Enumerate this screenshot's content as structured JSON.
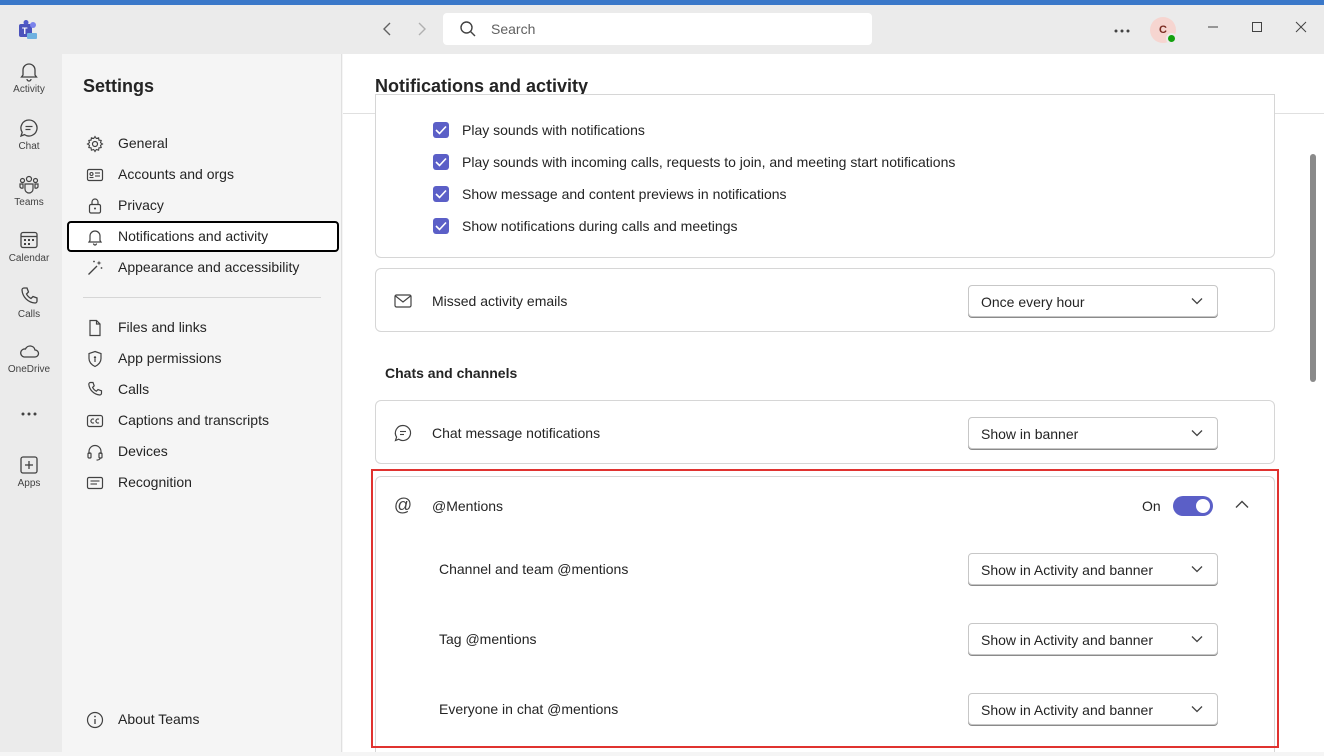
{
  "topbar": {
    "search_placeholder": "Search"
  },
  "user": {
    "initial": "C"
  },
  "rail": {
    "items": [
      {
        "label": "Activity",
        "icon": "bell-icon"
      },
      {
        "label": "Chat",
        "icon": "chat-icon"
      },
      {
        "label": "Teams",
        "icon": "teams-icon"
      },
      {
        "label": "Calendar",
        "icon": "calendar-icon"
      },
      {
        "label": "Calls",
        "icon": "phone-icon"
      },
      {
        "label": "OneDrive",
        "icon": "cloud-icon"
      },
      {
        "label": "",
        "icon": "more-icon"
      },
      {
        "label": "Apps",
        "icon": "apps-icon"
      }
    ]
  },
  "settings": {
    "title": "Settings",
    "nav": [
      {
        "label": "General",
        "icon": "gear-icon"
      },
      {
        "label": "Accounts and orgs",
        "icon": "id-card-icon"
      },
      {
        "label": "Privacy",
        "icon": "lock-icon"
      },
      {
        "label": "Notifications and activity",
        "icon": "bell-icon",
        "active": true
      },
      {
        "label": "Appearance and accessibility",
        "icon": "magic-wand-icon"
      },
      {
        "label": "Files and links",
        "icon": "file-icon"
      },
      {
        "label": "App permissions",
        "icon": "shield-icon"
      },
      {
        "label": "Calls",
        "icon": "phone-icon"
      },
      {
        "label": "Captions and transcripts",
        "icon": "captions-icon"
      },
      {
        "label": "Devices",
        "icon": "headset-icon"
      },
      {
        "label": "Recognition",
        "icon": "recognition-icon"
      }
    ],
    "about": "About Teams"
  },
  "main": {
    "title": "Notifications and activity",
    "checkboxes": [
      {
        "label": "Play sounds with notifications",
        "checked": true
      },
      {
        "label": "Play sounds with incoming calls, requests to join, and meeting start notifications",
        "checked": true
      },
      {
        "label": "Show message and content previews in notifications",
        "checked": true
      },
      {
        "label": "Show notifications during calls and meetings",
        "checked": true
      }
    ],
    "missed_emails": {
      "label": "Missed activity emails",
      "value": "Once every hour"
    },
    "chats_heading": "Chats and channels",
    "chat_notifications": {
      "label": "Chat message notifications",
      "value": "Show in banner"
    },
    "mentions": {
      "label": "@Mentions",
      "state_label": "On",
      "enabled": true,
      "rows": [
        {
          "label": "Channel and team @mentions",
          "value": "Show in Activity and banner"
        },
        {
          "label": "Tag @mentions",
          "value": "Show in Activity and banner"
        },
        {
          "label": "Everyone in chat @mentions",
          "value": "Show in Activity and banner"
        }
      ]
    }
  },
  "colors": {
    "accent": "#5b5fc7",
    "highlight": "#e0322f",
    "presence": "#13a10e"
  }
}
